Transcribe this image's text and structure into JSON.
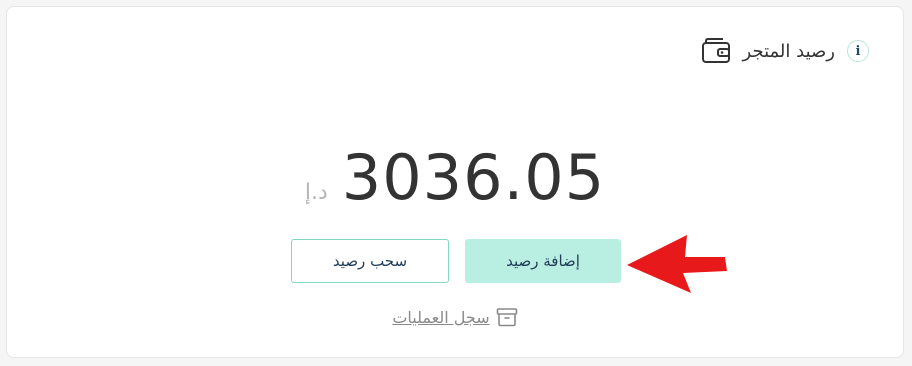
{
  "header": {
    "title": "رصيد المتجر",
    "info_glyph": "i",
    "icons": {
      "wallet": "wallet-icon",
      "info": "info-icon"
    }
  },
  "balance": {
    "amount": "3036.05",
    "currency": "د.إ"
  },
  "actions": {
    "add_label": "إضافة رصيد",
    "withdraw_label": "سحب رصيد"
  },
  "history": {
    "label": "سجل العمليات",
    "icon": "archive-icon"
  },
  "annotation": {
    "arrow_icon": "arrow-left-icon",
    "arrow_color": "#e8191b"
  },
  "colors": {
    "accent": "#b9efe3",
    "accent_border": "#7fd9c6",
    "text_dark": "#333333",
    "button_text": "#1f3b54"
  }
}
